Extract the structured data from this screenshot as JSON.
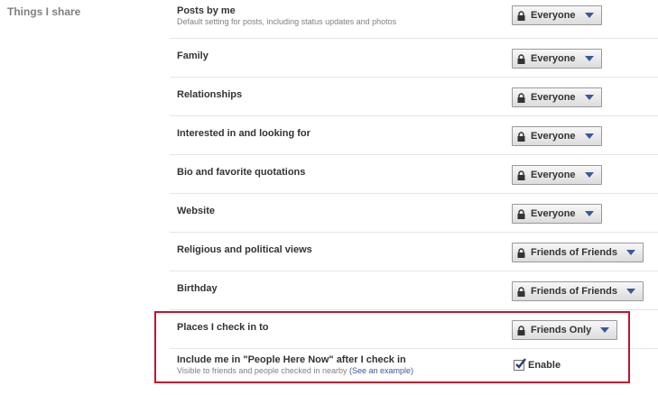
{
  "section": {
    "label": "Things I share"
  },
  "rows": [
    {
      "title": "Posts by me",
      "subtitle": "Default setting for posts, including status updates and photos",
      "value": "Everyone"
    },
    {
      "title": "Family",
      "value": "Everyone"
    },
    {
      "title": "Relationships",
      "value": "Everyone"
    },
    {
      "title": "Interested in and looking for",
      "value": "Everyone"
    },
    {
      "title": "Bio and favorite quotations",
      "value": "Everyone"
    },
    {
      "title": "Website",
      "value": "Everyone"
    },
    {
      "title": "Religious and political views",
      "value": "Friends of Friends"
    },
    {
      "title": "Birthday",
      "value": "Friends of Friends"
    },
    {
      "title": "Places I check in to",
      "value": "Friends Only"
    }
  ],
  "people_here_now": {
    "title": "Include me in \"People Here Now\" after I check in",
    "subtitle": "Visible to friends and people checked in nearby",
    "link": "(See an example)",
    "checkbox_label": "Enable",
    "checked": true
  },
  "icons": {
    "dropdown_lock": "lock-icon",
    "dropdown_caret": "caret-down-icon",
    "checkbox_mark": "checkmark-icon"
  },
  "colors": {
    "link": "#3b5998",
    "highlight": "#c8102e",
    "label_gray": "#808080"
  }
}
